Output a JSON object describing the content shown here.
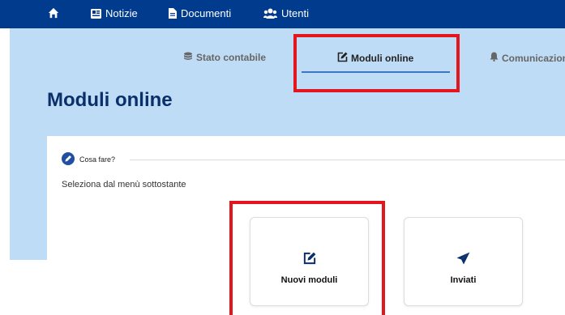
{
  "topnav": {
    "home_icon": "home-icon",
    "items": [
      {
        "label": "Notizie",
        "icon": "newspaper-icon"
      },
      {
        "label": "Documenti",
        "icon": "document-icon"
      },
      {
        "label": "Utenti",
        "icon": "users-icon"
      }
    ]
  },
  "subnav": {
    "tabs": [
      {
        "label": "Stato contabile",
        "icon": "coins-icon"
      },
      {
        "label": "Moduli online",
        "icon": "edit-icon",
        "active": true
      },
      {
        "label": "Comunicazioni",
        "icon": "bell-icon"
      }
    ]
  },
  "page": {
    "title": "Moduli online"
  },
  "section": {
    "heading": "Cosa fare?",
    "icon": "pencil-circle-icon",
    "subtitle": "Seleziona dal menù sottostante"
  },
  "tiles": [
    {
      "label": "Nuovi moduli",
      "icon": "edit-icon"
    },
    {
      "label": "Inviati",
      "icon": "paper-plane-icon"
    }
  ],
  "colors": {
    "topbar": "#003b8e",
    "background_band": "#bfdcf6",
    "title": "#0a2f6b",
    "highlight": "#e3151d",
    "tab_underline": "#3a78c4"
  }
}
